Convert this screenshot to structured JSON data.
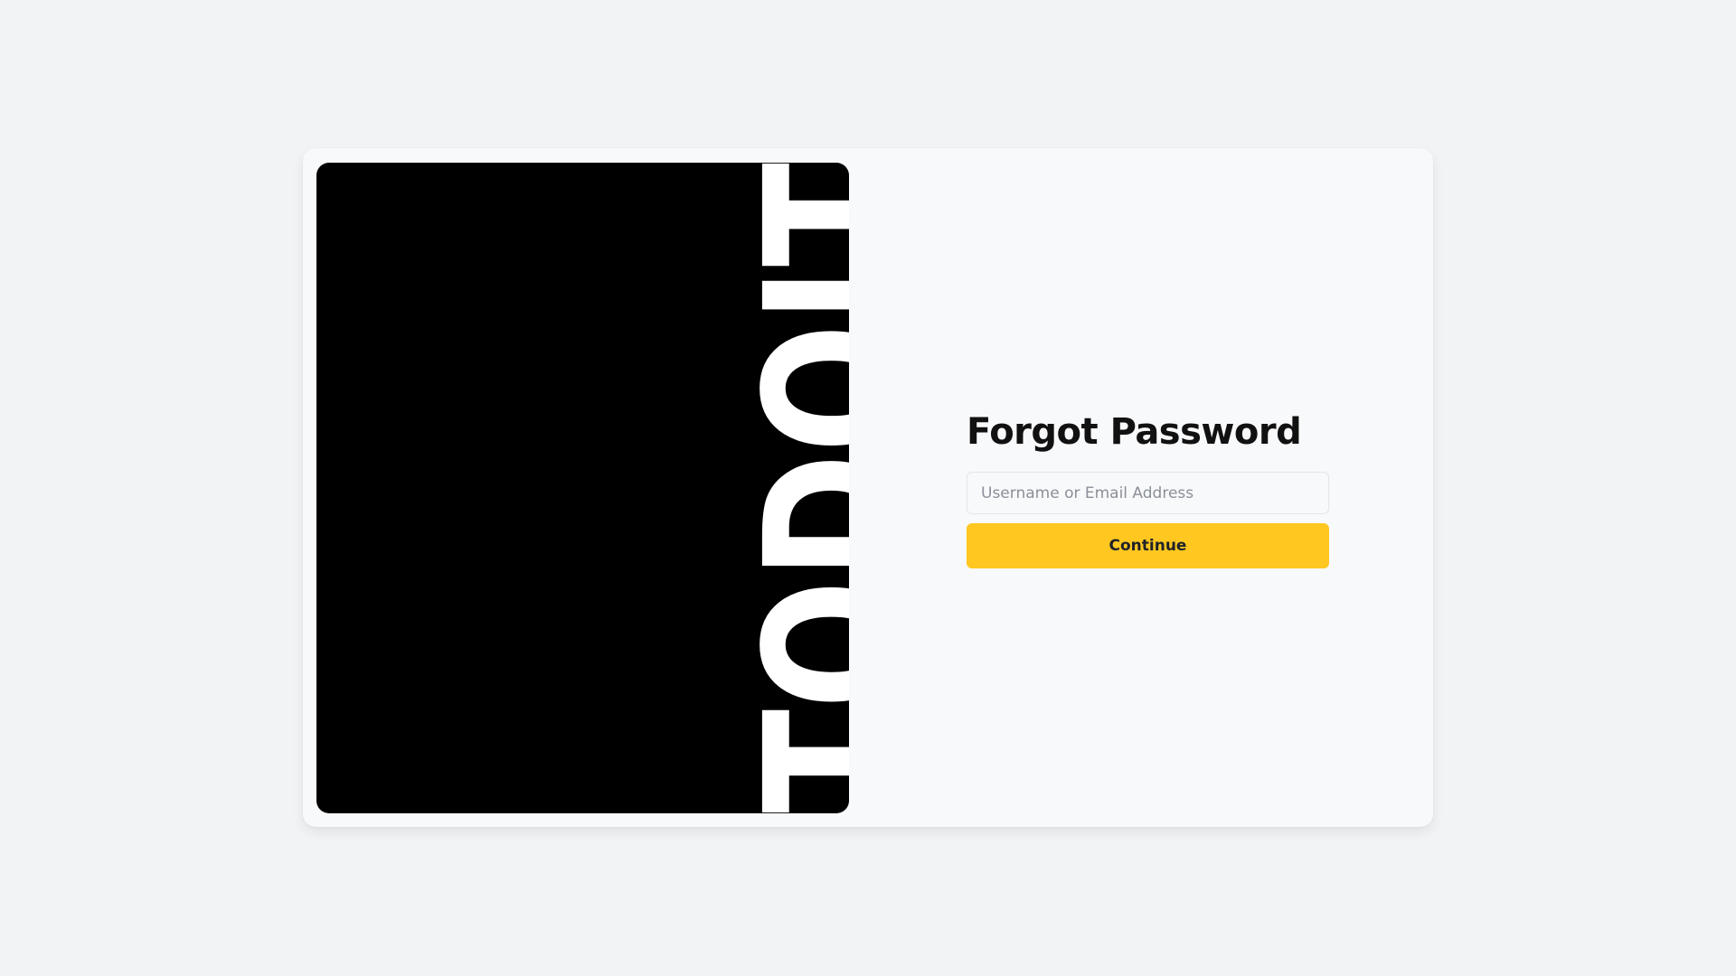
{
  "brand": {
    "wordmark": "TODOIT",
    "panel_color": "#000000",
    "text_color": "#ffffff"
  },
  "form": {
    "title": "Forgot Password",
    "username_field": {
      "placeholder": "Username or Email Address",
      "value": ""
    },
    "continue_label": "Continue"
  },
  "colors": {
    "page_background": "#f2f3f5",
    "card_background": "#f8f9fb",
    "accent": "#ffc720",
    "title_text": "#111111"
  }
}
